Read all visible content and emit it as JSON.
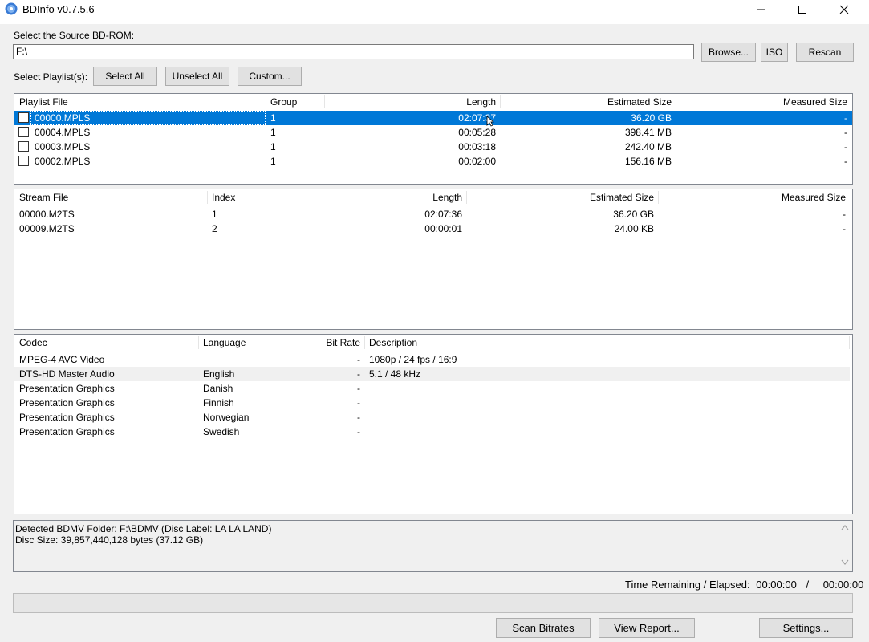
{
  "window": {
    "title": "BDInfo v0.7.5.6"
  },
  "source": {
    "label": "Select the Source BD-ROM:",
    "path_value": "F:\\",
    "browse_label": "Browse...",
    "iso_label": "ISO",
    "rescan_label": "Rescan"
  },
  "playlist_controls": {
    "label": "Select Playlist(s):",
    "select_all_label": "Select All",
    "unselect_all_label": "Unselect All",
    "custom_label": "Custom..."
  },
  "playlists": {
    "headers": [
      "Playlist File",
      "Group",
      "Length",
      "Estimated Size",
      "Measured Size"
    ],
    "rows": [
      {
        "file": "00000.MPLS",
        "group": "1",
        "length": "02:07:37",
        "estimated": "36.20 GB",
        "measured": "-",
        "selected": true
      },
      {
        "file": "00004.MPLS",
        "group": "1",
        "length": "00:05:28",
        "estimated": "398.41 MB",
        "measured": "-"
      },
      {
        "file": "00003.MPLS",
        "group": "1",
        "length": "00:03:18",
        "estimated": "242.40 MB",
        "measured": "-"
      },
      {
        "file": "00002.MPLS",
        "group": "1",
        "length": "00:02:00",
        "estimated": "156.16 MB",
        "measured": "-"
      }
    ]
  },
  "streams": {
    "headers": [
      "Stream File",
      "Index",
      "Length",
      "Estimated Size",
      "Measured Size"
    ],
    "rows": [
      {
        "file": "00000.M2TS",
        "index": "1",
        "length": "02:07:36",
        "estimated": "36.20 GB",
        "measured": "-"
      },
      {
        "file": "00009.M2TS",
        "index": "2",
        "length": "00:00:01",
        "estimated": "24.00 KB",
        "measured": "-"
      }
    ]
  },
  "codecs": {
    "headers": [
      "Codec",
      "Language",
      "Bit Rate",
      "Description"
    ],
    "rows": [
      {
        "codec": "MPEG-4 AVC Video",
        "language": "",
        "bitrate": "-",
        "description": "1080p / 24 fps / 16:9"
      },
      {
        "codec": "DTS-HD Master Audio",
        "language": "English",
        "bitrate": "-",
        "description": "5.1 / 48 kHz",
        "highlight": true
      },
      {
        "codec": "Presentation Graphics",
        "language": "Danish",
        "bitrate": "-",
        "description": ""
      },
      {
        "codec": "Presentation Graphics",
        "language": "Finnish",
        "bitrate": "-",
        "description": ""
      },
      {
        "codec": "Presentation Graphics",
        "language": "Norwegian",
        "bitrate": "-",
        "description": ""
      },
      {
        "codec": "Presentation Graphics",
        "language": "Swedish",
        "bitrate": "-",
        "description": ""
      }
    ]
  },
  "info": {
    "line1": "Detected BDMV Folder: F:\\BDMV (Disc Label: LA LA LAND)",
    "line2": "Disc Size: 39,857,440,128 bytes (37.12 GB)"
  },
  "status": {
    "label": "Time Remaining / Elapsed:",
    "remaining": "00:00:00",
    "separator": "/",
    "elapsed": "00:00:00",
    "progress": 0
  },
  "footer": {
    "scan_label": "Scan Bitrates",
    "report_label": "View Report...",
    "settings_label": "Settings..."
  },
  "icons": [
    "disc-icon",
    "minimize-icon",
    "maximize-icon",
    "close-icon",
    "scroll-up-icon",
    "scroll-down-icon",
    "mouse-cursor-icon"
  ],
  "colors": {
    "selection": "#0078d7",
    "window_bg": "#f0f0f0"
  }
}
